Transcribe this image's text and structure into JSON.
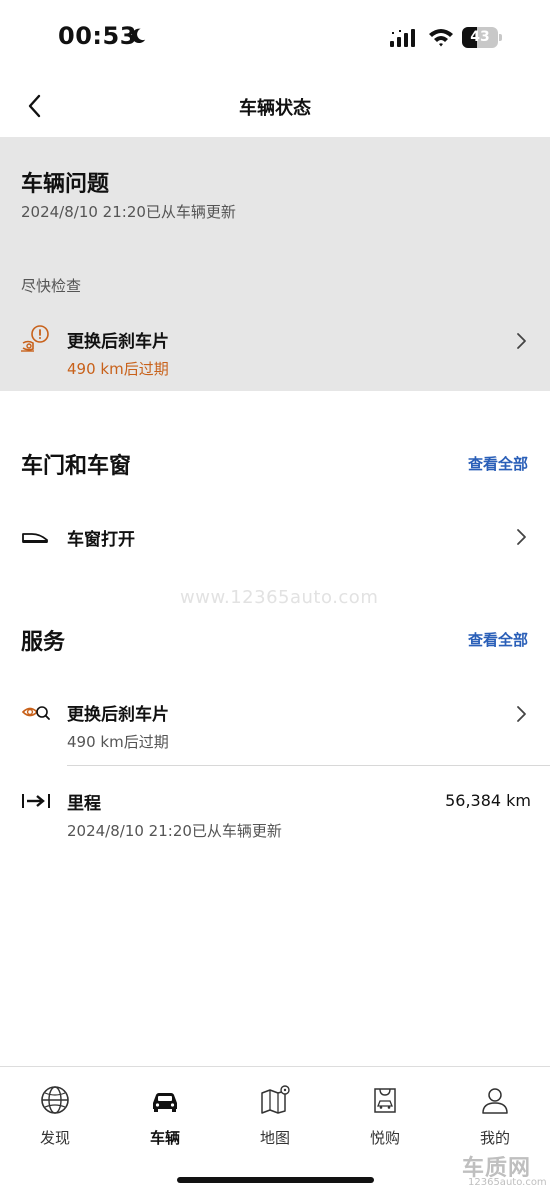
{
  "status_bar": {
    "time": "00:53",
    "battery": "43",
    "battery_level": 0.43
  },
  "nav": {
    "title": "车辆状态"
  },
  "vehicle_issues": {
    "title": "车辆问题",
    "updated": "2024/8/10 21:20已从车辆更新",
    "urgency_label": "尽快检查",
    "item": {
      "title": "更换后刹车片",
      "subtitle": "490 km后过期",
      "icon": "brake-warning-icon",
      "accent_color": "#c8611a"
    }
  },
  "doors_windows": {
    "title": "车门和车窗",
    "view_all": "查看全部",
    "item": {
      "title": "车窗打开",
      "icon": "window-open-icon"
    }
  },
  "service": {
    "title": "服务",
    "view_all": "查看全部",
    "items": [
      {
        "title": "更换后刹车片",
        "subtitle": "490 km后过期",
        "icon": "brake-service-icon"
      },
      {
        "title": "里程",
        "subtitle": "2024/8/10 21:20已从车辆更新",
        "value": "56,384 km",
        "icon": "odometer-icon"
      }
    ]
  },
  "watermark": "www.12365auto.com",
  "tabs": [
    {
      "label": "发现",
      "icon": "globe-icon",
      "active": false
    },
    {
      "label": "车辆",
      "icon": "car-icon",
      "active": true
    },
    {
      "label": "地图",
      "icon": "map-icon",
      "active": false
    },
    {
      "label": "悦购",
      "icon": "shopping-bag-icon",
      "active": false
    },
    {
      "label": "我的",
      "icon": "profile-icon",
      "active": false
    }
  ],
  "corner_logo": {
    "big": "车质网",
    "small": "12365auto.com"
  },
  "colors": {
    "accent_blue": "#2a5fb8",
    "warning_orange": "#c8611a",
    "issue_background": "#e6e6e6"
  }
}
